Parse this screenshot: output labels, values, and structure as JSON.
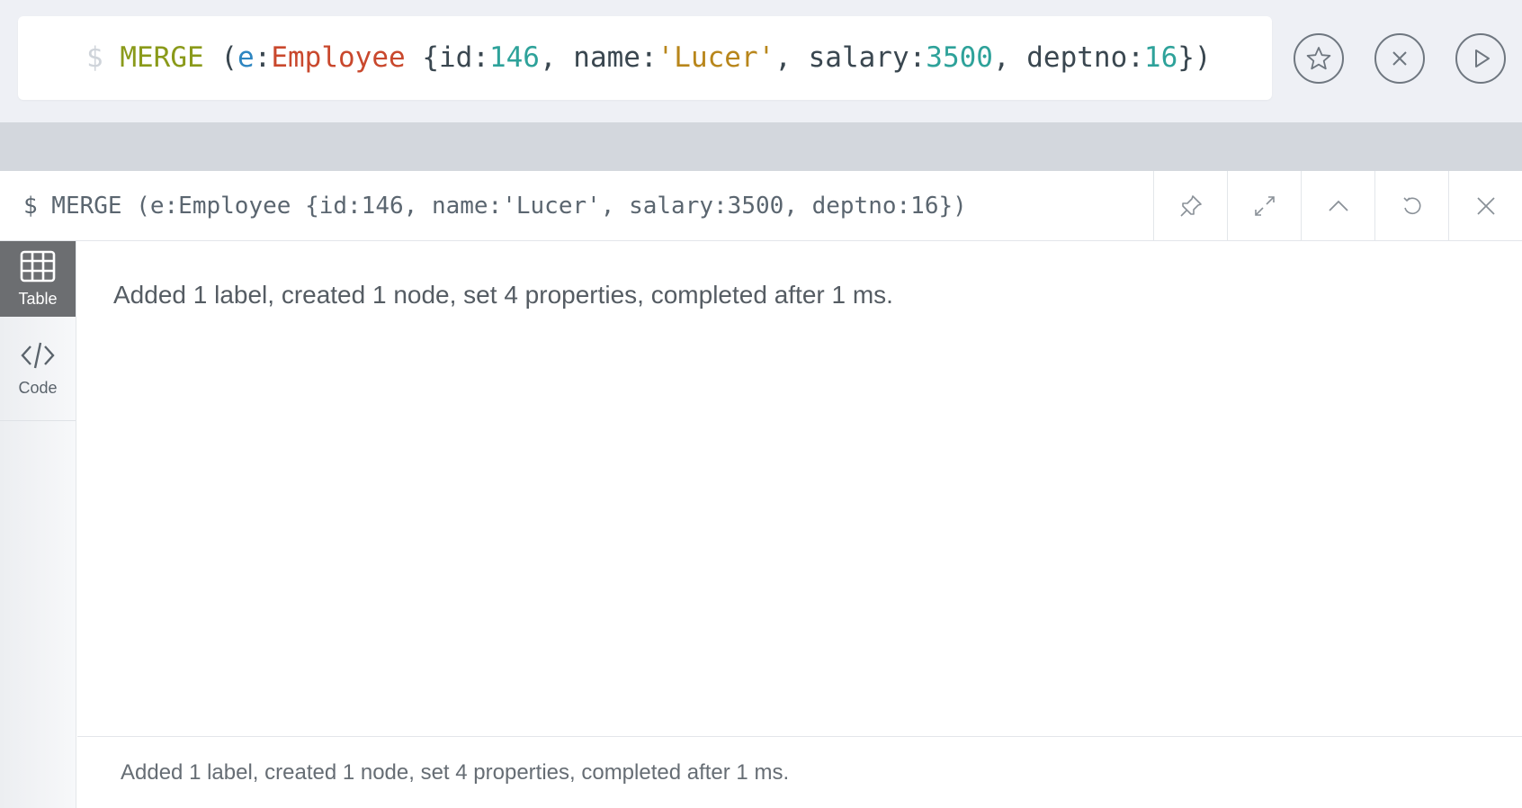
{
  "editor": {
    "prompt": "$",
    "tokens": [
      {
        "text": "MERGE",
        "kind": "keyword"
      },
      {
        "text": " (",
        "kind": "plain"
      },
      {
        "text": "e",
        "kind": "var"
      },
      {
        "text": ":",
        "kind": "plain"
      },
      {
        "text": "Employee",
        "kind": "label"
      },
      {
        "text": " {id:",
        "kind": "plain"
      },
      {
        "text": "146",
        "kind": "number"
      },
      {
        "text": ", name:",
        "kind": "plain"
      },
      {
        "text": "'Lucer'",
        "kind": "string"
      },
      {
        "text": ", salary:",
        "kind": "plain"
      },
      {
        "text": "3500",
        "kind": "number"
      },
      {
        "text": ", deptno:",
        "kind": "plain"
      },
      {
        "text": "16",
        "kind": "number"
      },
      {
        "text": "})",
        "kind": "plain"
      }
    ],
    "buttons": [
      {
        "name": "favorite-button",
        "icon": "star-icon"
      },
      {
        "name": "clear-button",
        "icon": "close-circle-icon"
      },
      {
        "name": "run-button",
        "icon": "play-icon"
      }
    ]
  },
  "frame": {
    "title": "$ MERGE (e:Employee {id:146, name:'Lucer', salary:3500, deptno:16})",
    "actions": [
      {
        "name": "pin-button",
        "icon": "pin-icon"
      },
      {
        "name": "fullscreen-button",
        "icon": "expand-icon"
      },
      {
        "name": "collapse-button",
        "icon": "chevron-up-icon"
      },
      {
        "name": "rerun-button",
        "icon": "refresh-icon"
      },
      {
        "name": "close-frame-button",
        "icon": "close-icon"
      }
    ],
    "tabs": [
      {
        "label": "Table",
        "icon": "table-icon",
        "active": true
      },
      {
        "label": "Code",
        "icon": "code-icon",
        "active": false
      }
    ],
    "result_message": "Added 1 label, created 1 node, set 4 properties, completed after 1 ms.",
    "status_message": "Added 1 label, created 1 node, set 4 properties, completed after 1 ms."
  },
  "colors": {
    "keyword": "#8a9a1a",
    "var": "#2e86c1",
    "label": "#c9482d",
    "number": "#2ea29a",
    "string": "#b8861b",
    "active_tab": "#6c6e71"
  }
}
